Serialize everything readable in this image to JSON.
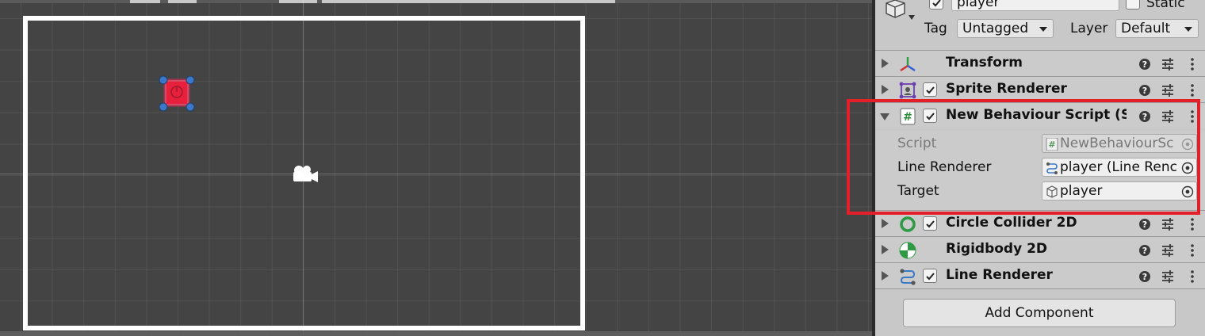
{
  "inspector": {
    "gameobject": {
      "active": true,
      "name": "player",
      "static_label": "Static",
      "static_checked": false,
      "tag_label": "Tag",
      "tag_value": "Untagged",
      "layer_label": "Layer",
      "layer_value": "Default"
    },
    "components": [
      {
        "id": "transform",
        "title": "Transform",
        "icon": "transform-icon",
        "has_checkbox": false,
        "expanded": false
      },
      {
        "id": "sprite-renderer",
        "title": "Sprite Renderer",
        "icon": "sprite-renderer-icon",
        "has_checkbox": true,
        "enabled": true,
        "expanded": false
      },
      {
        "id": "new-behaviour-script",
        "title": "New Behaviour Script (Sc",
        "icon": "script-icon",
        "has_checkbox": true,
        "enabled": true,
        "expanded": true
      },
      {
        "id": "circle-collider-2d",
        "title": "Circle Collider 2D",
        "icon": "circle-collider-icon",
        "has_checkbox": true,
        "enabled": true,
        "expanded": false
      },
      {
        "id": "rigidbody-2d",
        "title": "Rigidbody 2D",
        "icon": "rigidbody-icon",
        "has_checkbox": false,
        "expanded": false
      },
      {
        "id": "line-renderer",
        "title": "Line Renderer",
        "icon": "line-renderer-icon",
        "has_checkbox": true,
        "enabled": true,
        "expanded": false
      }
    ],
    "script_properties": [
      {
        "label": "Script",
        "value": "NewBehaviourSc",
        "icon": "script-icon",
        "disabled": true
      },
      {
        "label": "Line Renderer",
        "value": "player (Line Renc",
        "icon": "line-renderer-icon",
        "disabled": false
      },
      {
        "label": "Target",
        "value": "player",
        "icon": "cube-icon",
        "disabled": false
      }
    ],
    "add_component_label": "Add Component"
  },
  "colors": {
    "highlight": "#e3202a",
    "sprite_fill": "#e8203c",
    "handle_blue": "#3b78c8",
    "collider_green": "#2e9a45"
  }
}
